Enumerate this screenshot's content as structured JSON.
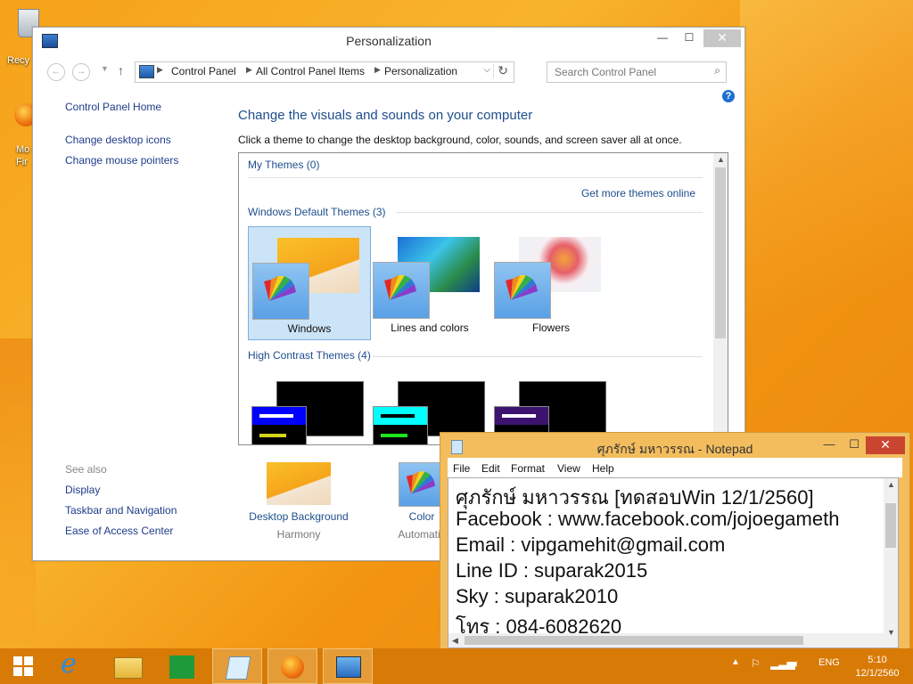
{
  "desktop": {
    "recycle_label": "Recy",
    "firefox_label1": "Mo",
    "firefox_label2": "Fir"
  },
  "window": {
    "title": "Personalization",
    "minimize": "—",
    "maximize": "☐",
    "close": "✕",
    "address": {
      "crumbs": [
        "Control Panel",
        "All Control Panel Items",
        "Personalization"
      ]
    },
    "search_placeholder": "Search Control Panel",
    "help": "?"
  },
  "leftnav": {
    "home": "Control Panel Home",
    "links": [
      "Change desktop icons",
      "Change mouse pointers"
    ],
    "see_also_title": "See also",
    "see_also": [
      "Display",
      "Taskbar and Navigation",
      "Ease of Access Center"
    ]
  },
  "main": {
    "heading": "Change the visuals and sounds on your computer",
    "subheading": "Click a theme to change the desktop background, color, sounds, and screen saver all at once.",
    "my_themes": "My Themes (0)",
    "get_more": "Get more themes online",
    "default_themes_title": "Windows Default Themes (3)",
    "default_themes": [
      {
        "label": "Windows",
        "selected": true
      },
      {
        "label": "Lines and colors",
        "selected": false
      },
      {
        "label": "Flowers",
        "selected": false
      }
    ],
    "high_contrast_title": "High Contrast Themes (4)",
    "high_contrast_colors": [
      "#0000ff",
      "#00ffff",
      "#3c1470"
    ]
  },
  "bottom": {
    "desktop_background": {
      "title": "Desktop Background",
      "sub": "Harmony"
    },
    "color": {
      "title": "Color",
      "sub": "Automatic"
    }
  },
  "notepad": {
    "title": "ศุภรักษ์  มหาวรรณ - Notepad",
    "menu": [
      "File",
      "Edit",
      "Format",
      "View",
      "Help"
    ],
    "lines": [
      "ศุภรักษ์  มหาวรรณ [ทดสอบWin 12/1/2560]",
      "Facebook : www.facebook.com/jojoegameth",
      "Email :  vipgamehit@gmail.com",
      "Line ID : suparak2015",
      "Sky : suparak2010",
      "โทร : 084-6082620"
    ]
  },
  "taskbar": {
    "lang": "ENG",
    "time": "5:10",
    "date": "12/1/2560"
  }
}
